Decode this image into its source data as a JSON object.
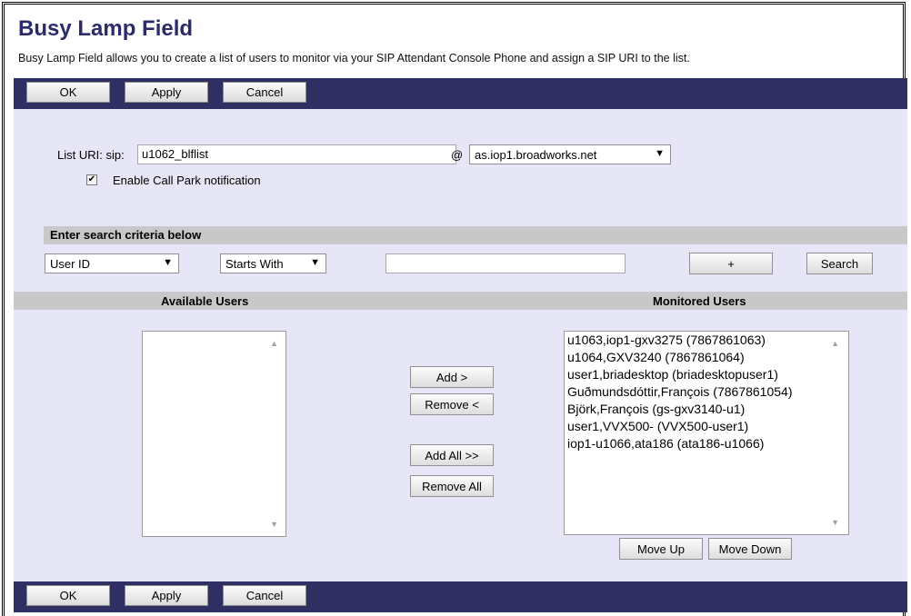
{
  "page": {
    "title": "Busy Lamp Field",
    "description": "Busy Lamp Field allows you to create a list of users to monitor via your SIP Attendant Console Phone and assign a SIP URI to the list."
  },
  "toolbar": {
    "ok": "OK",
    "apply": "Apply",
    "cancel": "Cancel"
  },
  "list_uri": {
    "label": "List URI: sip:",
    "value": "u1062_blflist",
    "at": "@",
    "domain": "as.iop1.broadworks.net"
  },
  "call_park": {
    "label": "Enable Call Park notification",
    "checked": true
  },
  "search": {
    "header": "Enter search criteria below",
    "field": "User ID",
    "mode": "Starts With",
    "value": "",
    "plus": "+",
    "button": "Search"
  },
  "available": {
    "header": "Available Users"
  },
  "monitored": {
    "header": "Monitored Users",
    "items": [
      "u1063,iop1-gxv3275 (7867861063)",
      "u1064,GXV3240 (7867861064)",
      "user1,briadesktop (briadesktopuser1)",
      "Guðmundsdóttir,François (7867861054)",
      "Björk,François (gs-gxv3140-u1)",
      "user1,VVX500- (VVX500-user1)",
      "iop1-u1066,ata186 (ata186-u1066)"
    ]
  },
  "actions": {
    "add": "Add >",
    "remove": "Remove <",
    "add_all": "Add All >>",
    "remove_all": "Remove All",
    "move_up": "Move Up",
    "move_down": "Move Down"
  },
  "icons": {
    "check": "✔",
    "caret": "▼",
    "scroll_up": "▲",
    "scroll_down": "▼"
  }
}
